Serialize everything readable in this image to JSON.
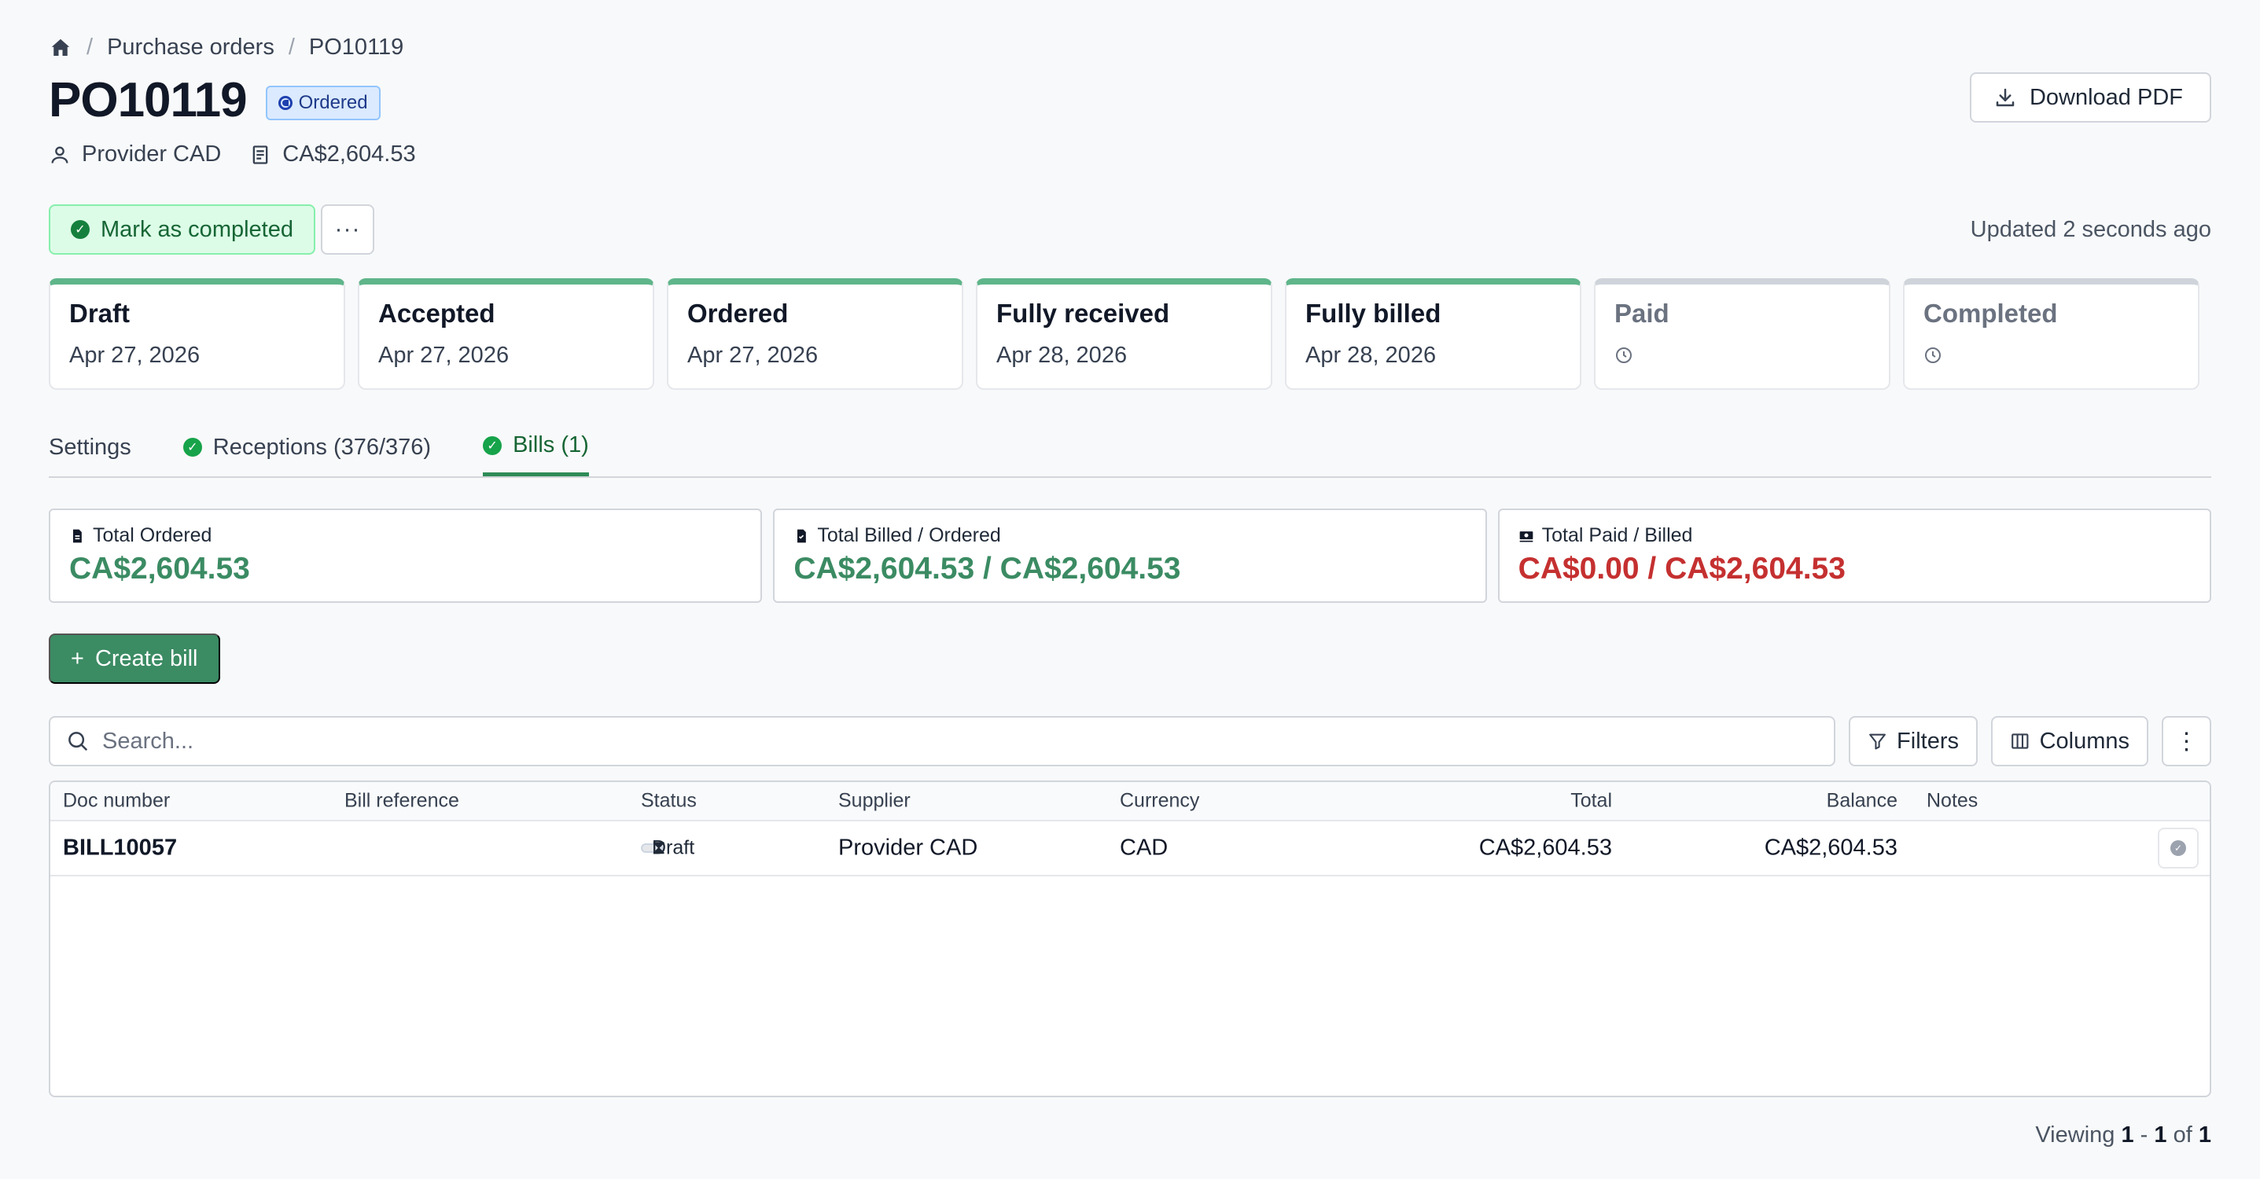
{
  "breadcrumb": {
    "home_icon": "home-icon",
    "items": [
      "Purchase orders",
      "PO10119"
    ],
    "separator": "/"
  },
  "header": {
    "title": "PO10119",
    "status": "Ordered",
    "download_label": "Download PDF",
    "supplier": "Provider CAD",
    "amount": "CA$2,604.53"
  },
  "actions": {
    "mark_completed_label": "Mark as completed",
    "more_label": "···",
    "updated_text": "Updated 2 seconds ago"
  },
  "steps": [
    {
      "name": "Draft",
      "date": "Apr 27, 2026",
      "done": true
    },
    {
      "name": "Accepted",
      "date": "Apr 27, 2026",
      "done": true
    },
    {
      "name": "Ordered",
      "date": "Apr 27, 2026",
      "done": true
    },
    {
      "name": "Fully received",
      "date": "Apr 28, 2026",
      "done": true
    },
    {
      "name": "Fully billed",
      "date": "Apr 28, 2026",
      "done": true
    },
    {
      "name": "Paid",
      "date": "",
      "done": false
    },
    {
      "name": "Completed",
      "date": "",
      "done": false
    }
  ],
  "tabs": [
    {
      "label": "Settings",
      "active": false,
      "check": false
    },
    {
      "label": "Receptions (376/376)",
      "active": false,
      "check": true
    },
    {
      "label": "Bills (1)",
      "active": true,
      "check": true
    }
  ],
  "summary": {
    "total_ordered_label": "Total Ordered",
    "total_ordered_value": "CA$2,604.53",
    "total_billed_label": "Total Billed / Ordered",
    "total_billed_value": "CA$2,604.53 / CA$2,604.53",
    "total_paid_label": "Total Paid / Billed",
    "total_paid_value": "CA$0.00 / CA$2,604.53",
    "colors": {
      "positive": "#3b8b63",
      "negative": "#c53030"
    }
  },
  "toolbar": {
    "create_label": "Create bill",
    "search_placeholder": "Search...",
    "filters_label": "Filters",
    "columns_label": "Columns",
    "kebab_label": "⋮"
  },
  "table": {
    "headers": {
      "doc": "Doc number",
      "ref": "Bill reference",
      "status": "Status",
      "supplier": "Supplier",
      "currency": "Currency",
      "total": "Total",
      "balance": "Balance",
      "notes": "Notes"
    },
    "rows": [
      {
        "doc": "BILL10057",
        "ref": "",
        "status": "Draft",
        "supplier": "Provider CAD",
        "currency": "CAD",
        "total": "CA$2,604.53",
        "balance": "CA$2,604.53",
        "notes": ""
      }
    ]
  },
  "pagination": {
    "prefix": "Viewing",
    "start": "1",
    "dash": "-",
    "end": "1",
    "of": "of",
    "total": "1"
  }
}
